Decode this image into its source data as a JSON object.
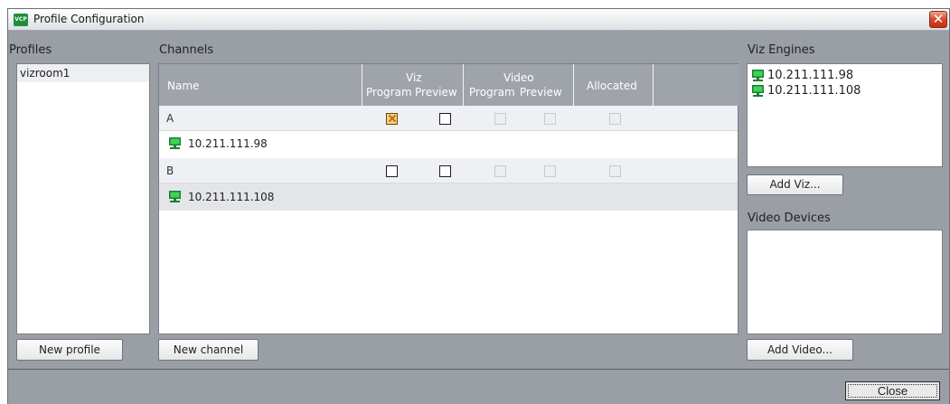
{
  "window": {
    "title": "Profile Configuration",
    "app_icon": "VCP",
    "close_icon": "✕"
  },
  "profiles": {
    "label": "Profiles",
    "items": [
      "vizroom1"
    ],
    "new_button": "New profile"
  },
  "channels": {
    "label": "Channels",
    "columns": {
      "name": "Name",
      "viz": "Viz",
      "viz_program": "Program",
      "viz_preview": "Preview",
      "video": "Video",
      "video_program": "Program",
      "video_preview": "Preview",
      "allocated": "Allocated"
    },
    "rows": [
      {
        "name": "A",
        "engine": "10.211.111.98",
        "viz_program": true,
        "viz_preview": false
      },
      {
        "name": "B",
        "engine": "10.211.111.108",
        "viz_program": false,
        "viz_preview": false
      }
    ],
    "new_button": "New channel"
  },
  "viz_engines": {
    "label": "Viz Engines",
    "items": [
      "10.211.111.98",
      "10.211.111.108"
    ],
    "add_button": "Add Viz..."
  },
  "video_devices": {
    "label": "Video Devices",
    "add_button": "Add Video..."
  },
  "footer": {
    "close_button": "Close"
  },
  "colors": {
    "window_bg": "#9a9ea5",
    "header_bg": "#9fa3aa",
    "engine_icon": "#1e9a3c"
  },
  "icons": {
    "engine": "computer-monitor-icon"
  }
}
